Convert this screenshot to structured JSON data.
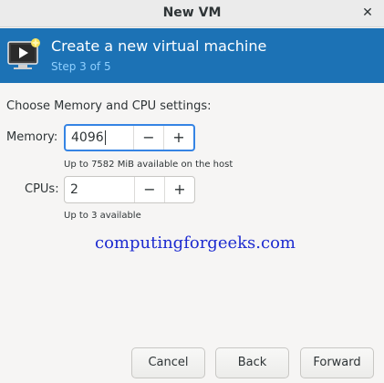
{
  "window": {
    "title": "New VM",
    "close_symbol": "✕"
  },
  "banner": {
    "heading": "Create a new virtual machine",
    "step": "Step 3 of 5",
    "icon": "virtual-machine-icon",
    "color": "#1c72b5"
  },
  "form": {
    "section_label": "Choose Memory and CPU settings:",
    "memory": {
      "label": "Memory:",
      "value": "4096",
      "hint": "Up to 7582 MiB available on the host"
    },
    "cpus": {
      "label": "CPUs:",
      "value": "2",
      "hint": "Up to 3 available"
    },
    "decrement_symbol": "−",
    "increment_symbol": "+"
  },
  "watermark": "computingforgeeks.com",
  "footer": {
    "cancel_label": "Cancel",
    "back_label": "Back",
    "forward_label": "Forward"
  }
}
